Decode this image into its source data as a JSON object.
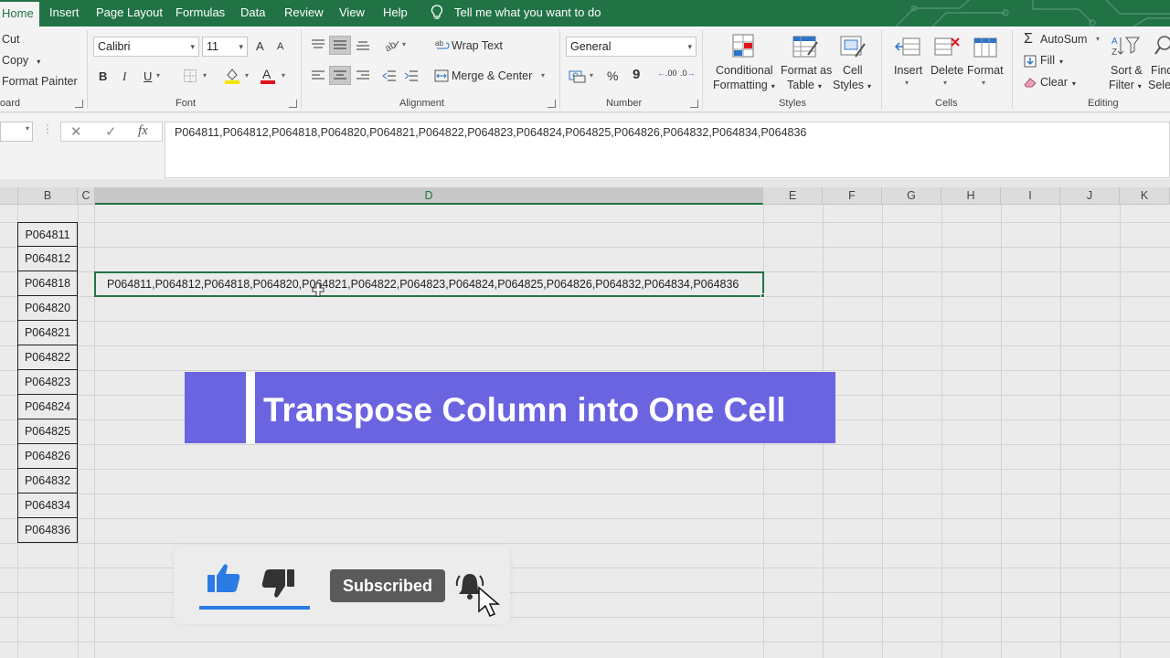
{
  "menu": {
    "tabs": [
      "Home",
      "Insert",
      "Page Layout",
      "Formulas",
      "Data",
      "Review",
      "View",
      "Help"
    ],
    "tell_me": "Tell me what you want to do"
  },
  "ribbon": {
    "clipboard": {
      "cut": "Cut",
      "copy": "Copy",
      "format_painter": "Format Painter",
      "label": "oard"
    },
    "font": {
      "name": "Calibri",
      "size": "11",
      "bold": "B",
      "italic": "I",
      "underline": "U",
      "label": "Font",
      "grow": "A",
      "shrink": "A"
    },
    "alignment": {
      "wrap_text": "Wrap Text",
      "merge_center": "Merge & Center",
      "label": "Alignment"
    },
    "number": {
      "format": "General",
      "percent": "%",
      "comma": "9",
      "label": "Number",
      "inc_dec": ".00",
      "dec_dec": ".0"
    },
    "styles": {
      "conditional_1": "Conditional",
      "conditional_2": "Formatting",
      "format_as_1": "Format as",
      "format_as_2": "Table",
      "cell_1": "Cell",
      "cell_2": "Styles",
      "label": "Styles"
    },
    "cells": {
      "insert": "Insert",
      "delete": "Delete",
      "format": "Format",
      "label": "Cells"
    },
    "editing": {
      "autosum": "AutoSum",
      "fill": "Fill",
      "clear": "Clear",
      "sort_1": "Sort &",
      "sort_2": "Filter",
      "find_1": "Find",
      "find_2": "Sele",
      "label": "Editing"
    }
  },
  "formula_bar": {
    "cancel": "✕",
    "enter": "✓",
    "fx": "fx",
    "content": "P064811,P064812,P064818,P064820,P064821,P064822,P064823,P064824,P064825,P064826,P064832,P064834,P064836"
  },
  "sheet": {
    "columns": [
      "B",
      "C",
      "D",
      "E",
      "F",
      "G",
      "H",
      "I",
      "J",
      "K"
    ],
    "column_b": [
      "P064811",
      "P064812",
      "P064818",
      "P064820",
      "P064821",
      "P064822",
      "P064823",
      "P064824",
      "P064825",
      "P064826",
      "P064832",
      "P064834",
      "P064836"
    ],
    "d_cell": "P064811,P064812,P064818,P064820,P064821,P064822,P064823,P064824,P064825,P064826,P064832,P064834,P064836"
  },
  "overlay": {
    "banner_title": "Transpose Column into One Cell",
    "subscribe_label": "Subscribed",
    "colors": {
      "banner": "#6a64e0",
      "excel_green": "#217346",
      "like_blue": "#2c7be5"
    }
  }
}
